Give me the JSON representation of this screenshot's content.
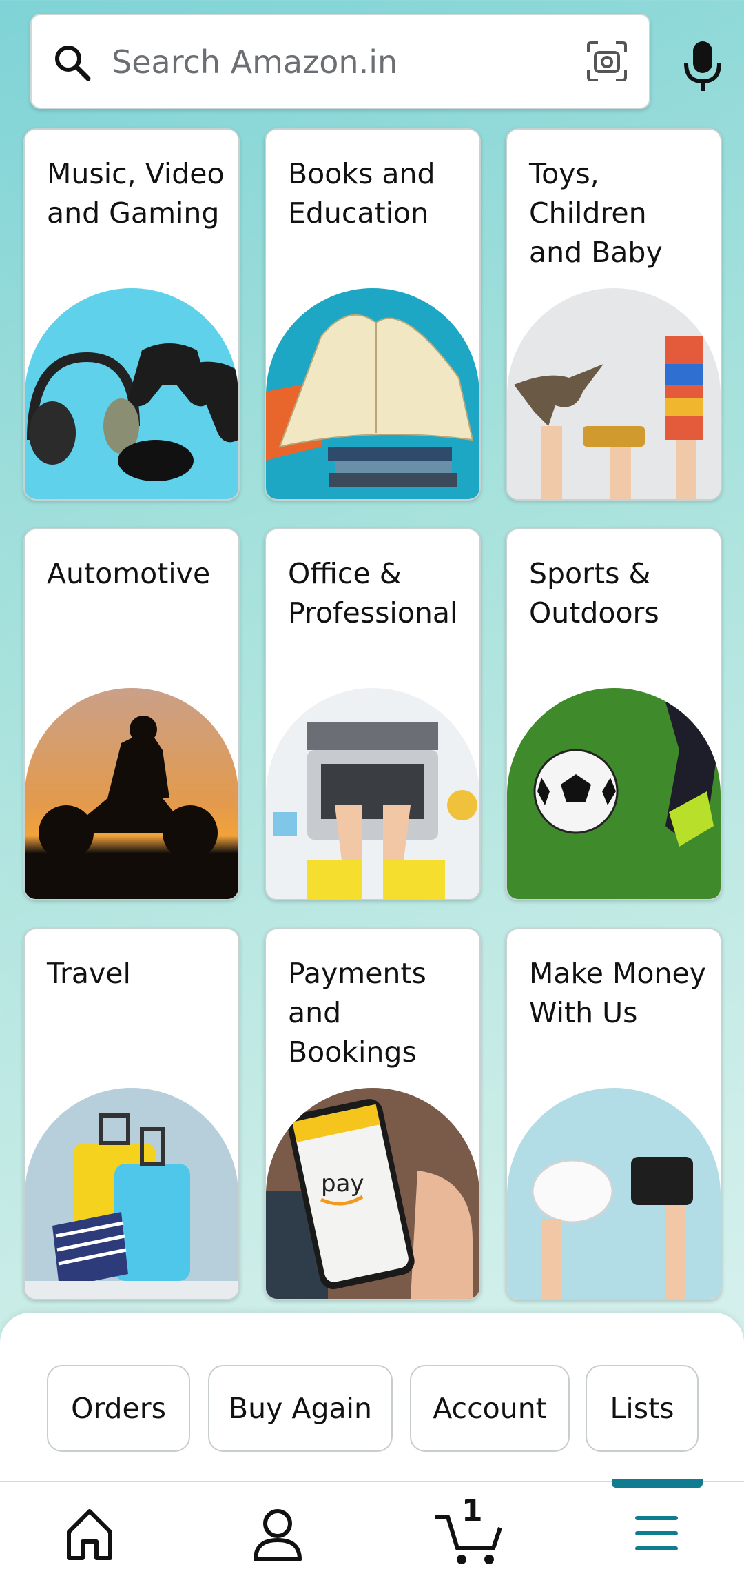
{
  "search": {
    "placeholder": "Search Amazon.in"
  },
  "categories": [
    {
      "title": "Music, Video and Gaming"
    },
    {
      "title": "Books and Education"
    },
    {
      "title": "Toys, Children and Baby"
    },
    {
      "title": "Automotive"
    },
    {
      "title": "Office & Professional"
    },
    {
      "title": "Sports & Outdoors"
    },
    {
      "title": "Travel"
    },
    {
      "title": "Payments and Bookings"
    },
    {
      "title": "Make Money With Us"
    }
  ],
  "payments_art_text": "pay",
  "quick_links": [
    "Orders",
    "Buy Again",
    "Account",
    "Lists"
  ],
  "nav": {
    "items": [
      "home-icon",
      "account-icon",
      "cart-icon",
      "menu-icon"
    ],
    "cart_count": "1",
    "active_color": "#0f7c90"
  }
}
